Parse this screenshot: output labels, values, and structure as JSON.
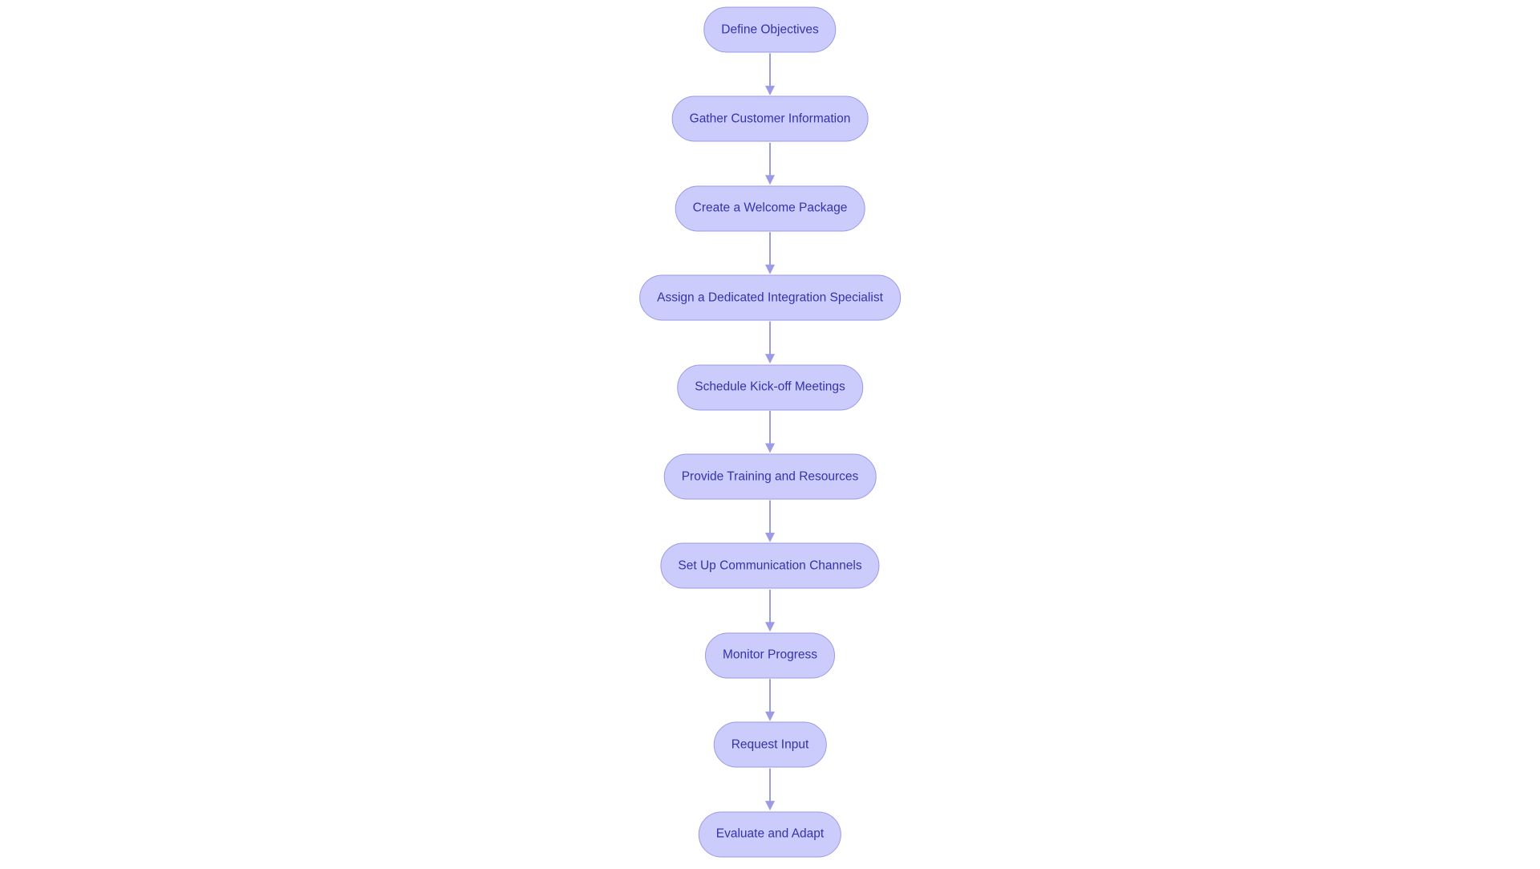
{
  "diagram": {
    "type": "flowchart",
    "direction": "top-to-bottom",
    "colors": {
      "node_fill": "#cbcbfc",
      "node_stroke": "#9a9ae6",
      "text": "#3434a8",
      "edge": "#9a9ae6"
    },
    "nodes": [
      {
        "label": "Define Objectives"
      },
      {
        "label": "Gather Customer Information"
      },
      {
        "label": "Create a Welcome Package"
      },
      {
        "label": "Assign a Dedicated Integration Specialist"
      },
      {
        "label": "Schedule Kick-off Meetings"
      },
      {
        "label": "Provide Training and Resources"
      },
      {
        "label": "Set Up Communication Channels"
      },
      {
        "label": "Monitor Progress"
      },
      {
        "label": "Request Input"
      },
      {
        "label": "Evaluate and Adapt"
      }
    ]
  }
}
